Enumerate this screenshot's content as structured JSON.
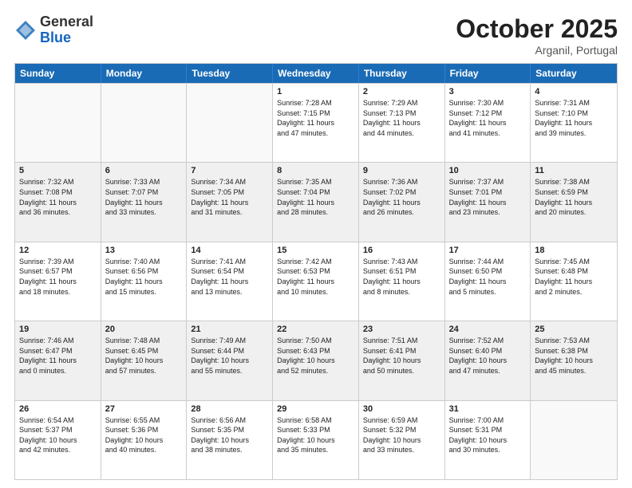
{
  "header": {
    "logo_general": "General",
    "logo_blue": "Blue",
    "month": "October 2025",
    "location": "Arganil, Portugal"
  },
  "weekdays": [
    "Sunday",
    "Monday",
    "Tuesday",
    "Wednesday",
    "Thursday",
    "Friday",
    "Saturday"
  ],
  "rows": [
    [
      {
        "day": "",
        "text": "",
        "empty": true
      },
      {
        "day": "",
        "text": "",
        "empty": true
      },
      {
        "day": "",
        "text": "",
        "empty": true
      },
      {
        "day": "1",
        "text": "Sunrise: 7:28 AM\nSunset: 7:15 PM\nDaylight: 11 hours\nand 47 minutes."
      },
      {
        "day": "2",
        "text": "Sunrise: 7:29 AM\nSunset: 7:13 PM\nDaylight: 11 hours\nand 44 minutes."
      },
      {
        "day": "3",
        "text": "Sunrise: 7:30 AM\nSunset: 7:12 PM\nDaylight: 11 hours\nand 41 minutes."
      },
      {
        "day": "4",
        "text": "Sunrise: 7:31 AM\nSunset: 7:10 PM\nDaylight: 11 hours\nand 39 minutes."
      }
    ],
    [
      {
        "day": "5",
        "text": "Sunrise: 7:32 AM\nSunset: 7:08 PM\nDaylight: 11 hours\nand 36 minutes.",
        "shaded": true
      },
      {
        "day": "6",
        "text": "Sunrise: 7:33 AM\nSunset: 7:07 PM\nDaylight: 11 hours\nand 33 minutes.",
        "shaded": true
      },
      {
        "day": "7",
        "text": "Sunrise: 7:34 AM\nSunset: 7:05 PM\nDaylight: 11 hours\nand 31 minutes.",
        "shaded": true
      },
      {
        "day": "8",
        "text": "Sunrise: 7:35 AM\nSunset: 7:04 PM\nDaylight: 11 hours\nand 28 minutes.",
        "shaded": true
      },
      {
        "day": "9",
        "text": "Sunrise: 7:36 AM\nSunset: 7:02 PM\nDaylight: 11 hours\nand 26 minutes.",
        "shaded": true
      },
      {
        "day": "10",
        "text": "Sunrise: 7:37 AM\nSunset: 7:01 PM\nDaylight: 11 hours\nand 23 minutes.",
        "shaded": true
      },
      {
        "day": "11",
        "text": "Sunrise: 7:38 AM\nSunset: 6:59 PM\nDaylight: 11 hours\nand 20 minutes.",
        "shaded": true
      }
    ],
    [
      {
        "day": "12",
        "text": "Sunrise: 7:39 AM\nSunset: 6:57 PM\nDaylight: 11 hours\nand 18 minutes."
      },
      {
        "day": "13",
        "text": "Sunrise: 7:40 AM\nSunset: 6:56 PM\nDaylight: 11 hours\nand 15 minutes."
      },
      {
        "day": "14",
        "text": "Sunrise: 7:41 AM\nSunset: 6:54 PM\nDaylight: 11 hours\nand 13 minutes."
      },
      {
        "day": "15",
        "text": "Sunrise: 7:42 AM\nSunset: 6:53 PM\nDaylight: 11 hours\nand 10 minutes."
      },
      {
        "day": "16",
        "text": "Sunrise: 7:43 AM\nSunset: 6:51 PM\nDaylight: 11 hours\nand 8 minutes."
      },
      {
        "day": "17",
        "text": "Sunrise: 7:44 AM\nSunset: 6:50 PM\nDaylight: 11 hours\nand 5 minutes."
      },
      {
        "day": "18",
        "text": "Sunrise: 7:45 AM\nSunset: 6:48 PM\nDaylight: 11 hours\nand 2 minutes."
      }
    ],
    [
      {
        "day": "19",
        "text": "Sunrise: 7:46 AM\nSunset: 6:47 PM\nDaylight: 11 hours\nand 0 minutes.",
        "shaded": true
      },
      {
        "day": "20",
        "text": "Sunrise: 7:48 AM\nSunset: 6:45 PM\nDaylight: 10 hours\nand 57 minutes.",
        "shaded": true
      },
      {
        "day": "21",
        "text": "Sunrise: 7:49 AM\nSunset: 6:44 PM\nDaylight: 10 hours\nand 55 minutes.",
        "shaded": true
      },
      {
        "day": "22",
        "text": "Sunrise: 7:50 AM\nSunset: 6:43 PM\nDaylight: 10 hours\nand 52 minutes.",
        "shaded": true
      },
      {
        "day": "23",
        "text": "Sunrise: 7:51 AM\nSunset: 6:41 PM\nDaylight: 10 hours\nand 50 minutes.",
        "shaded": true
      },
      {
        "day": "24",
        "text": "Sunrise: 7:52 AM\nSunset: 6:40 PM\nDaylight: 10 hours\nand 47 minutes.",
        "shaded": true
      },
      {
        "day": "25",
        "text": "Sunrise: 7:53 AM\nSunset: 6:38 PM\nDaylight: 10 hours\nand 45 minutes.",
        "shaded": true
      }
    ],
    [
      {
        "day": "26",
        "text": "Sunrise: 6:54 AM\nSunset: 5:37 PM\nDaylight: 10 hours\nand 42 minutes."
      },
      {
        "day": "27",
        "text": "Sunrise: 6:55 AM\nSunset: 5:36 PM\nDaylight: 10 hours\nand 40 minutes."
      },
      {
        "day": "28",
        "text": "Sunrise: 6:56 AM\nSunset: 5:35 PM\nDaylight: 10 hours\nand 38 minutes."
      },
      {
        "day": "29",
        "text": "Sunrise: 6:58 AM\nSunset: 5:33 PM\nDaylight: 10 hours\nand 35 minutes."
      },
      {
        "day": "30",
        "text": "Sunrise: 6:59 AM\nSunset: 5:32 PM\nDaylight: 10 hours\nand 33 minutes."
      },
      {
        "day": "31",
        "text": "Sunrise: 7:00 AM\nSunset: 5:31 PM\nDaylight: 10 hours\nand 30 minutes."
      },
      {
        "day": "",
        "text": "",
        "empty": true
      }
    ]
  ]
}
